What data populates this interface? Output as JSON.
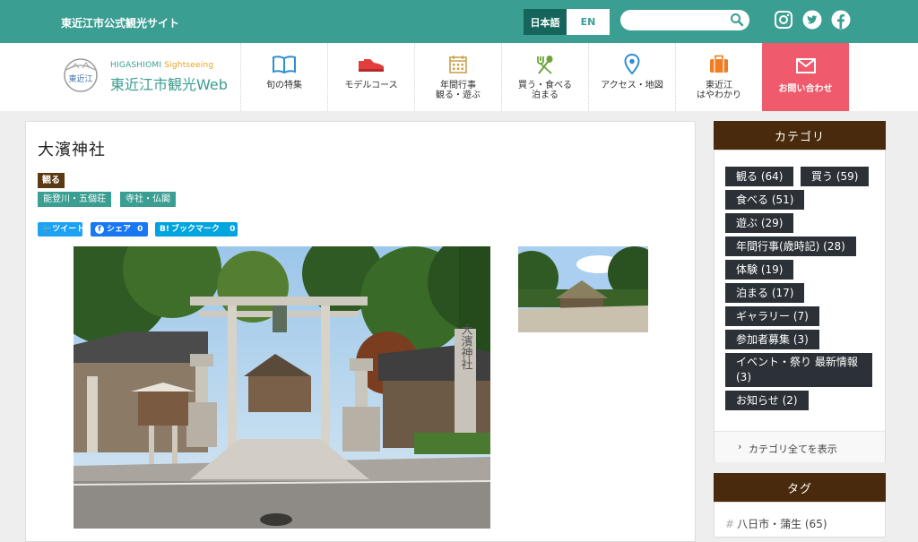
{
  "header": {
    "site_name": "東近江市公式観光サイト",
    "lang_ja": "日本語",
    "lang_en": "EN",
    "search_value": "",
    "accent_color": "#3a9e92"
  },
  "logo": {
    "seal_text": "東近江",
    "en_a": "HIGASHIOMI",
    "en_b": " Sightseeing",
    "ja": "東近江市観光Web"
  },
  "nav": {
    "items": [
      {
        "label": "旬の特集",
        "icon": "book-icon"
      },
      {
        "label": "モデルコース",
        "icon": "shoe-icon"
      },
      {
        "label": "年間行事\n観る・遊ぶ",
        "icon": "calendar-icon"
      },
      {
        "label": "買う・食べる\n泊まる",
        "icon": "fork-spoon-icon"
      },
      {
        "label": "アクセス・地図",
        "icon": "map-pin-icon"
      },
      {
        "label": "東近江\nはやわかり",
        "icon": "suitcase-icon"
      }
    ],
    "contact_label": "お問い合わせ"
  },
  "article": {
    "title": "大濱神社",
    "category": "観る",
    "tags": [
      "能登川・五個荘",
      "寺社・仏閣"
    ],
    "share": {
      "tweet": "ツイート",
      "fb": "シェア",
      "fb_count": "0",
      "hb": "ブックマーク",
      "hb_count": "0"
    },
    "shrine_plaque": "大濱神社"
  },
  "sidebar": {
    "categories_title": "カテゴリ",
    "categories": [
      "観る (64)",
      "買う (59)",
      "食べる (51)",
      "遊ぶ (29)",
      "年間行事(歳時記) (28)",
      "体験 (19)",
      "泊まる (17)",
      "ギャラリー (7)",
      "参加者募集 (3)",
      "イベント・祭り 最新情報 (3)",
      "お知らせ (2)"
    ],
    "show_all": "カテゴリ全てを表示",
    "tags_title": "タグ",
    "first_tag": "八日市・蒲生 (65)"
  }
}
